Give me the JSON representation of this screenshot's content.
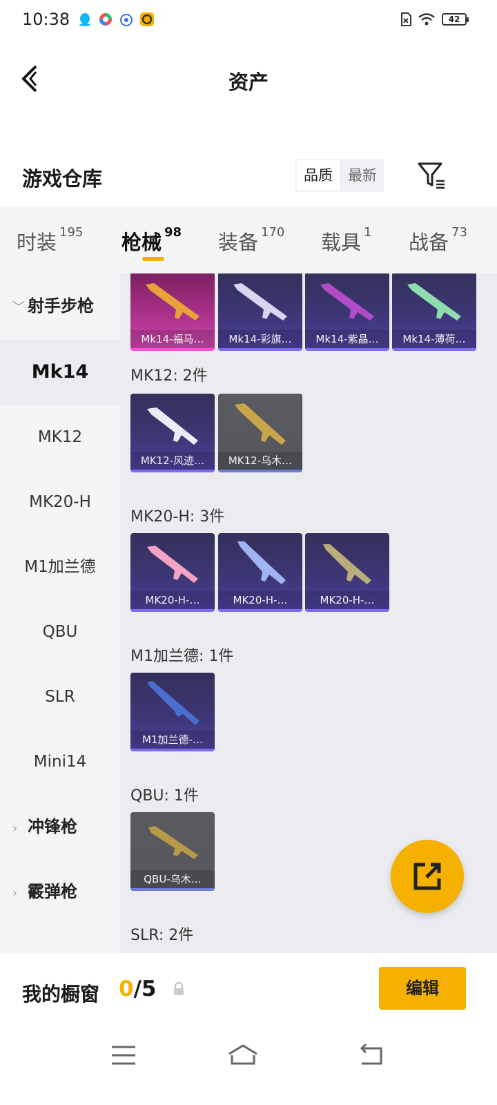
{
  "status_bar": {
    "time": "10:38",
    "battery": "42"
  },
  "nav": {
    "title": "资产"
  },
  "warehouse": {
    "title": "游戏仓库",
    "sort_options": [
      "品质",
      "最新"
    ]
  },
  "tabs": [
    {
      "label": "时装",
      "count": "195"
    },
    {
      "label": "枪械",
      "count": "98"
    },
    {
      "label": "装备",
      "count": "170"
    },
    {
      "label": "载具",
      "count": "1"
    },
    {
      "label": "战备",
      "count": "73"
    }
  ],
  "sidebar": {
    "groups": [
      "射手步枪",
      "冲锋枪",
      "霰弹枪"
    ],
    "items": [
      "Mk14",
      "MK12",
      "MK20-H",
      "M1加兰德",
      "QBU",
      "SLR",
      "Mini14"
    ]
  },
  "content": {
    "mk14_cards": [
      "Mk14-福马…",
      "Mk14-彩旗…",
      "Mk14-紫晶…",
      "Mk14-薄荷…"
    ],
    "mk12": {
      "label": "MK12: 2件",
      "cards": [
        "MK12-风迹…",
        "MK12-乌木…"
      ]
    },
    "mk20h": {
      "label": "MK20-H: 3件",
      "cards": [
        "MK20-H-…",
        "MK20-H-…",
        "MK20-H-…"
      ]
    },
    "m1": {
      "label": "M1加兰德: 1件",
      "cards": [
        "M1加兰德-…"
      ]
    },
    "qbu": {
      "label": "QBU: 1件",
      "cards": [
        "QBU-乌木…"
      ]
    },
    "slr": {
      "label": "SLR: 2件"
    }
  },
  "showcase": {
    "label": "我的橱窗",
    "current": "0",
    "total": "/5",
    "edit_label": "编辑"
  },
  "colors": {
    "accent": "#f5b000",
    "card_purple": "#3d3675",
    "card_pink": "#b0338f",
    "card_grey": "#55565c"
  }
}
